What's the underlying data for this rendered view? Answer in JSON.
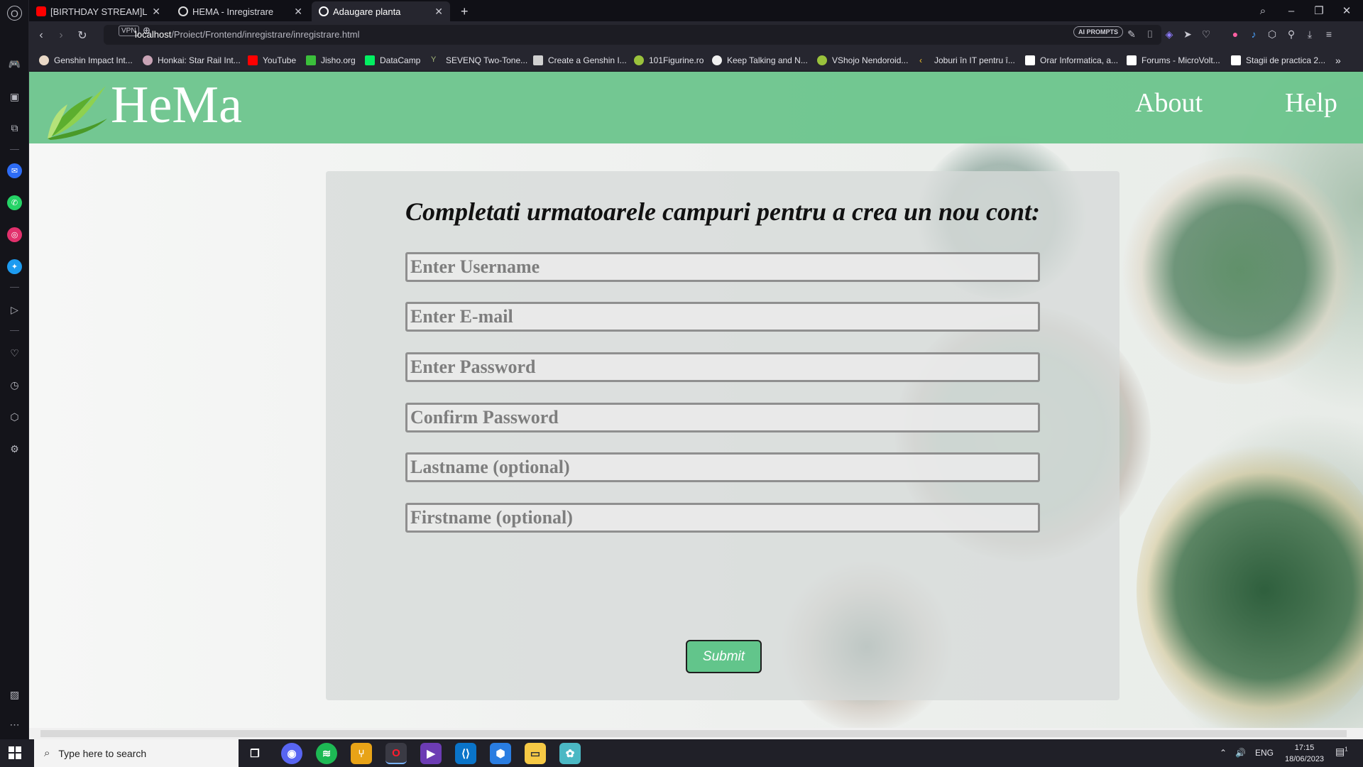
{
  "browser": {
    "tabs": [
      {
        "title": "[BIRTHDAY STREAM]Let's",
        "favicon": "youtube-icon",
        "color": "#ff0000"
      },
      {
        "title": "HEMA - Inregistrare",
        "favicon": "globe-icon",
        "color": "#ffffff"
      },
      {
        "title": "Adaugare planta",
        "favicon": "globe-icon",
        "color": "#ffffff"
      }
    ],
    "vpn_label": "VPN",
    "url_host": "localhost",
    "url_path": "/Proiect/Frontend/inregistrare/inregistrare.html",
    "ai_prompts_label": "AI PROMPTS",
    "bookmarks": [
      {
        "label": "Genshin Impact Int...",
        "color": "#e9d8c6"
      },
      {
        "label": "Honkai: Star Rail Int...",
        "color": "#c9a4b6"
      },
      {
        "label": "YouTube",
        "color": "#ff0000"
      },
      {
        "label": "Jisho.org",
        "color": "#3bbf3b"
      },
      {
        "label": "DataCamp",
        "color": "#03ef62"
      },
      {
        "label": "SEVENQ Two-Tone...",
        "color": "#a5b87a"
      },
      {
        "label": "Create a Genshin I...",
        "color": "#d0d0d0"
      },
      {
        "label": "101Figurine.ro",
        "color": "#9ac23c"
      },
      {
        "label": "Keep Talking and N...",
        "color": "#f0f0f0"
      },
      {
        "label": "VShojo Nendoroid...",
        "color": "#9ac23c"
      },
      {
        "label": "Joburi în IT pentru î...",
        "color": "#f3c22b"
      },
      {
        "label": "Orar Informatica, a...",
        "color": "#ffffff"
      },
      {
        "label": "Forums - MicroVolt...",
        "color": "#ffffff"
      },
      {
        "label": "Stagii de practica 2...",
        "color": "#ffffff"
      }
    ]
  },
  "site": {
    "brand": "HeMa",
    "nav": {
      "about": "About",
      "help": "Help"
    },
    "header_color": "#6cc48c"
  },
  "form": {
    "heading": "Completati urmatoarele campuri pentru a crea un nou cont:",
    "fields": [
      {
        "placeholder": "Enter Username"
      },
      {
        "placeholder": "Enter E-mail"
      },
      {
        "placeholder": "Enter Password"
      },
      {
        "placeholder": "Confirm Password"
      },
      {
        "placeholder": "Lastname (optional)"
      },
      {
        "placeholder": "Firstname (optional)"
      }
    ],
    "submit_label": "Submit",
    "submit_color": "#62c58b"
  },
  "taskbar": {
    "search_placeholder": "Type here to search",
    "language": "ENG",
    "time": "17:15",
    "date": "18/06/2023",
    "notifications": "1"
  }
}
